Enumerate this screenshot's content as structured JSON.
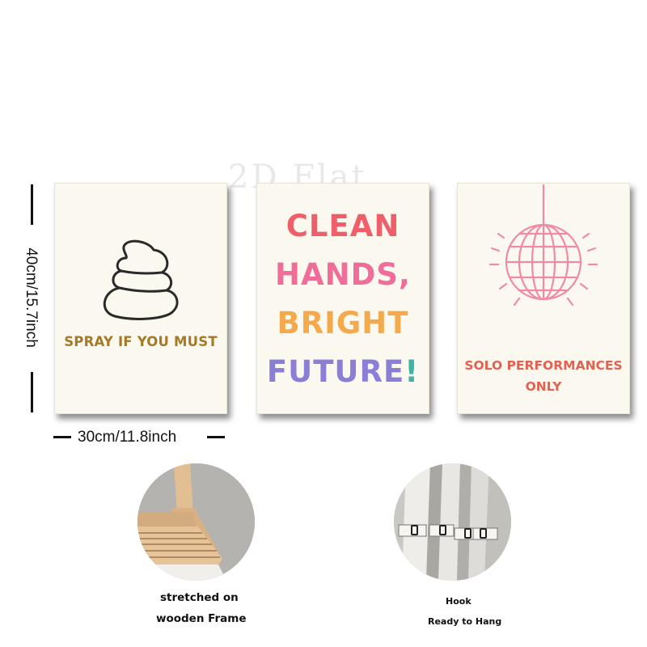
{
  "watermark": "2D Flat",
  "panels": [
    {
      "text": "SPRAY IF YOU MUST",
      "icon": "poop-outline-icon",
      "color": "#a47a26"
    },
    {
      "lines": [
        "CLEAN",
        "HANDS,",
        "BRIGHT",
        "FUTURE"
      ],
      "bang": "!",
      "colors": [
        "#ee5f6a",
        "#ef6d98",
        "#f4a94a",
        "#8a7ed6",
        "#3fb4a5"
      ]
    },
    {
      "lines": [
        "SOLO PERFORMANCES",
        "ONLY"
      ],
      "icon": "disco-ball-icon",
      "color": "#e36150"
    }
  ],
  "dimensions": {
    "height": "40cm/15.7inch",
    "width": "30cm/11.8inch"
  },
  "features": [
    {
      "caption_lines": [
        "stretched on",
        "wooden Frame"
      ],
      "icon": "wooden-frame-photo"
    },
    {
      "caption_lines": [
        "Hook",
        "Ready to Hang"
      ],
      "icon": "hook-photo"
    }
  ]
}
